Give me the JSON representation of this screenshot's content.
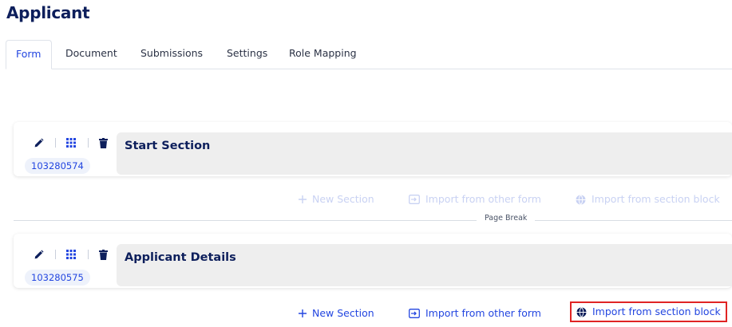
{
  "page": {
    "title": "Applicant"
  },
  "tabs": [
    {
      "label": "Form",
      "active": true
    },
    {
      "label": "Document",
      "active": false
    },
    {
      "label": "Submissions",
      "active": false
    },
    {
      "label": "Settings",
      "active": false
    },
    {
      "label": "Role Mapping",
      "active": false
    }
  ],
  "sections": [
    {
      "id": "103280574",
      "title": "Start Section"
    },
    {
      "id": "103280575",
      "title": "Applicant Details"
    }
  ],
  "actions": {
    "new_section": "New Section",
    "import_other_form": "Import from other form",
    "import_section_block": "Import from section block"
  },
  "page_break": {
    "label": "Page Break"
  },
  "icons": [
    "pencil-icon",
    "grid-drag-icon",
    "trash-icon",
    "plus-icon",
    "import-icon",
    "globe-icon"
  ],
  "colors": {
    "accent": "#2346e0",
    "title": "#0d1f5c",
    "highlight": "#e02424",
    "faded": "#c9d2f3"
  }
}
